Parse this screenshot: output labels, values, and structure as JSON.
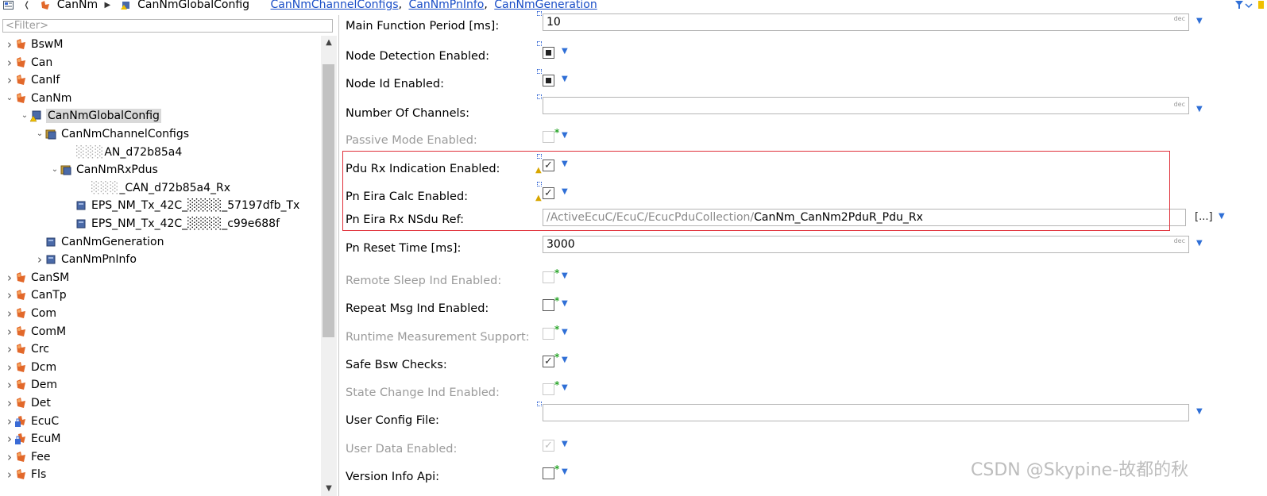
{
  "breadcrumb": {
    "items": [
      {
        "label": "CanNm",
        "kind": "text"
      },
      {
        "label": "CanNmGlobalConfig",
        "kind": "text"
      }
    ],
    "links": [
      "CanNmChannelConfigs",
      "CanNmPnInfo",
      "CanNmGeneration"
    ]
  },
  "filter": {
    "placeholder": "<Filter>"
  },
  "tree": [
    {
      "label": "BswM",
      "level": 0,
      "twisty": "collapsed",
      "icon": "module-icon"
    },
    {
      "label": "Can",
      "level": 0,
      "twisty": "collapsed",
      "icon": "module-icon"
    },
    {
      "label": "CanIf",
      "level": 0,
      "twisty": "collapsed",
      "icon": "module-icon"
    },
    {
      "label": "CanNm",
      "level": 0,
      "twisty": "expanded",
      "icon": "module-icon"
    },
    {
      "label": "CanNmGlobalConfig",
      "level": 1,
      "twisty": "expanded",
      "icon": "container-warning-icon",
      "selected": true
    },
    {
      "label": "CanNmChannelConfigs",
      "level": 2,
      "twisty": "expanded",
      "icon": "container-folder-icon"
    },
    {
      "label": "AN_d72b85a4",
      "level": 3,
      "twisty": "none",
      "icon": "none",
      "blurred_prefix": "░░░"
    },
    {
      "label": "CanNmRxPdus",
      "level": 3,
      "twisty": "expanded",
      "icon": "container-folder-icon"
    },
    {
      "label": "_CAN_d72b85a4_Rx",
      "level": 4,
      "twisty": "none",
      "icon": "none",
      "blurred_prefix": "░░░"
    },
    {
      "label": "EPS_NM_Tx_42C_░░░░_57197dfb_Tx",
      "level": 4,
      "twisty": "none",
      "icon": "container-icon"
    },
    {
      "label": "EPS_NM_Tx_42C_░░░░_c99e688f",
      "level": 4,
      "twisty": "none",
      "icon": "container-icon"
    },
    {
      "label": "CanNmGeneration",
      "level": 2,
      "twisty": "none",
      "icon": "container-icon"
    },
    {
      "label": "CanNmPnInfo",
      "level": 2,
      "twisty": "collapsed",
      "icon": "container-icon"
    },
    {
      "label": "CanSM",
      "level": 0,
      "twisty": "collapsed",
      "icon": "module-icon"
    },
    {
      "label": "CanTp",
      "level": 0,
      "twisty": "collapsed",
      "icon": "module-icon"
    },
    {
      "label": "Com",
      "level": 0,
      "twisty": "collapsed",
      "icon": "module-icon"
    },
    {
      "label": "ComM",
      "level": 0,
      "twisty": "collapsed",
      "icon": "module-icon"
    },
    {
      "label": "Crc",
      "level": 0,
      "twisty": "collapsed",
      "icon": "module-icon"
    },
    {
      "label": "Dcm",
      "level": 0,
      "twisty": "collapsed",
      "icon": "module-icon"
    },
    {
      "label": "Dem",
      "level": 0,
      "twisty": "collapsed",
      "icon": "module-icon"
    },
    {
      "label": "Det",
      "level": 0,
      "twisty": "collapsed",
      "icon": "module-icon"
    },
    {
      "label": "EcuC",
      "level": 0,
      "twisty": "collapsed",
      "icon": "module-lock-icon"
    },
    {
      "label": "EcuM",
      "level": 0,
      "twisty": "collapsed",
      "icon": "module-lock-icon"
    },
    {
      "label": "Fee",
      "level": 0,
      "twisty": "collapsed",
      "icon": "module-icon"
    },
    {
      "label": "Fls",
      "level": 0,
      "twisty": "collapsed",
      "icon": "module-icon"
    }
  ],
  "form": {
    "main_function_period": {
      "label": "Main Function Period [ms]:",
      "value": "10",
      "unit_hint": "dec"
    },
    "node_detection_enabled": {
      "label": "Node Detection Enabled:",
      "state": "filled"
    },
    "node_id_enabled": {
      "label": "Node Id Enabled:",
      "state": "filled"
    },
    "number_of_channels": {
      "label": "Number Of Channels:",
      "value": "",
      "unit_hint": "dec"
    },
    "passive_mode_enabled": {
      "label": "Passive Mode Enabled:",
      "state": "unchecked-disabled"
    },
    "pdu_rx_indication_enabled": {
      "label": "Pdu Rx Indication Enabled:",
      "state": "checked",
      "check": "✓"
    },
    "pn_eira_calc_enabled": {
      "label": "Pn Eira Calc Enabled:",
      "state": "checked",
      "check": "✓"
    },
    "pn_eira_rx_nsdu_ref": {
      "label": "Pn Eira Rx NSdu Ref:",
      "path_prefix": "/ActiveEcuC/EcuC/EcucPduCollection/",
      "path_value": "CanNm_CanNm2PduR_Pdu_Rx",
      "browse_label": "[...]"
    },
    "pn_reset_time": {
      "label": "Pn Reset Time [ms]:",
      "value": "3000",
      "unit_hint": "dec"
    },
    "remote_sleep_ind_enabled": {
      "label": "Remote Sleep Ind Enabled:",
      "state": "unchecked-disabled"
    },
    "repeat_msg_ind_enabled": {
      "label": "Repeat Msg Ind Enabled:",
      "state": "unchecked"
    },
    "runtime_measurement_support": {
      "label": "Runtime Measurement Support:",
      "state": "unchecked-disabled"
    },
    "safe_bsw_checks": {
      "label": "Safe Bsw Checks:",
      "state": "checked",
      "check": "✓"
    },
    "state_change_ind_enabled": {
      "label": "State Change Ind Enabled:",
      "state": "unchecked-disabled"
    },
    "user_config_file": {
      "label": "User Config File:",
      "value": ""
    },
    "user_data_enabled": {
      "label": "User Data Enabled:",
      "state": "checked-disabled",
      "check": "✓"
    },
    "version_info_api": {
      "label": "Version Info Api:",
      "state": "unchecked"
    }
  },
  "watermark": "CSDN @Skypine-故都的秋",
  "colors": {
    "link": "#1a4ec7",
    "highlight": "#e0303a",
    "dropdown": "#2f6fd6",
    "star": "#2aa52a"
  }
}
